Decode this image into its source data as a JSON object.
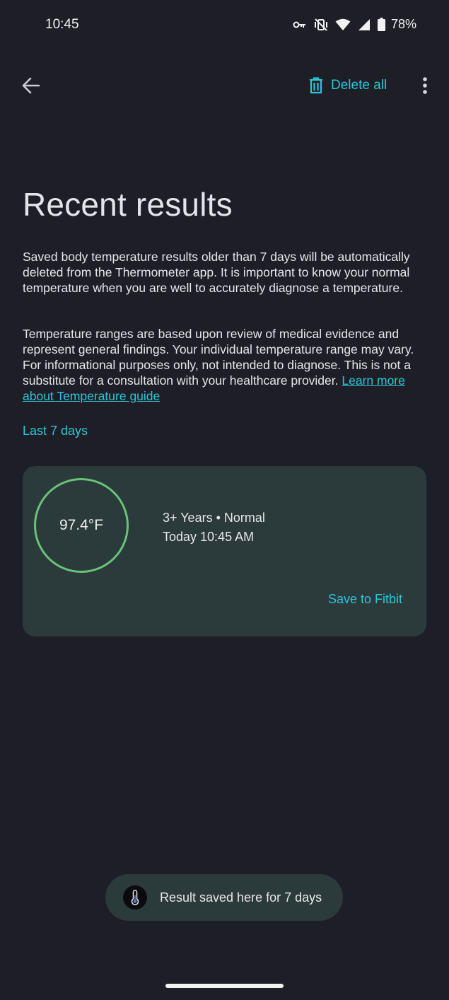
{
  "status_bar": {
    "time": "10:45",
    "battery": "78%",
    "icons": [
      "vpn-key-icon",
      "vibrate-off-icon",
      "wifi-icon",
      "signal-icon",
      "battery-icon"
    ]
  },
  "app_bar": {
    "delete_all_label": "Delete all",
    "icons": [
      "back-arrow-icon",
      "trash-icon",
      "more-vert-icon"
    ]
  },
  "page": {
    "title": "Recent results",
    "para1": "Saved body temperature results older than 7 days will be automatically deleted from the Thermometer app. It is important to know your normal temperature when you are well to accurately diagnose a temperature.",
    "para2": "Temperature ranges are based upon review of medical evidence and represent general findings. Your individual temperature range may vary. For informational purposes only, not intended to diagnose. This is not a substitute for a consultation with your healthcare provider. ",
    "learn_more_link": "Learn more about Temperature guide",
    "section_label": "Last 7 days"
  },
  "results": [
    {
      "temperature": "97.4°F",
      "category": "3+ Years • Normal",
      "timestamp": "Today 10:45 AM",
      "save_label": "Save to Fitbit"
    }
  ],
  "snackbar": {
    "text": "Result saved here for 7 days",
    "icon": "thermometer-icon"
  },
  "colors": {
    "background": "#1e1f26",
    "accent": "#2ec4d9",
    "card": "#2b3a3b",
    "normal_ring": "#69c27a"
  }
}
